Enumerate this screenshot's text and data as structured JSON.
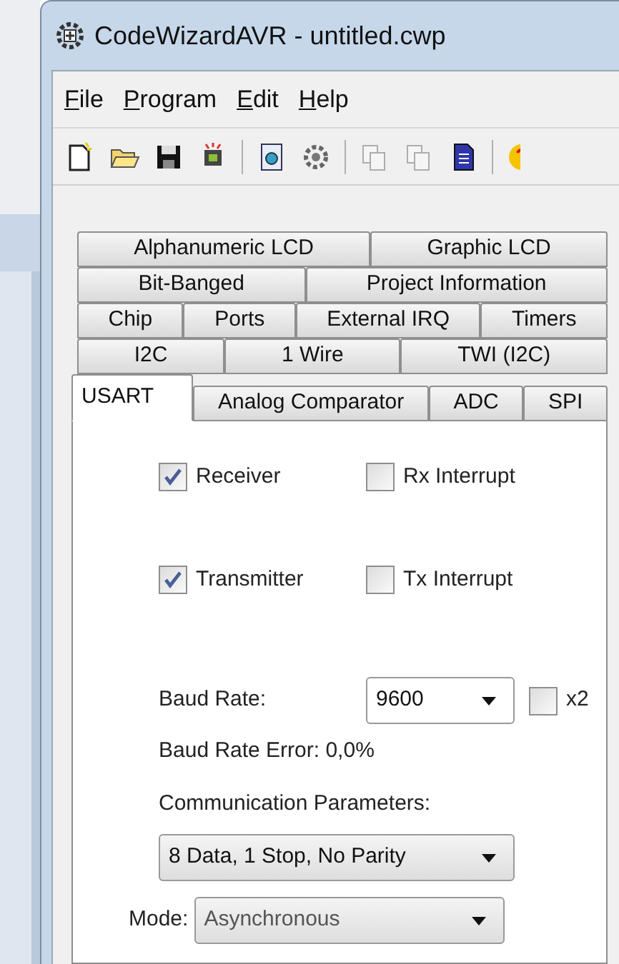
{
  "window": {
    "title": "CodeWizardAVR - untitled.cwp"
  },
  "menu": [
    {
      "label": "File"
    },
    {
      "label": "Program"
    },
    {
      "label": "Edit"
    },
    {
      "label": "Help"
    }
  ],
  "toolbar": [
    {
      "kind": "new",
      "disabled": false
    },
    {
      "kind": "open",
      "disabled": false
    },
    {
      "kind": "save",
      "disabled": false
    },
    {
      "kind": "chip",
      "disabled": false
    },
    {
      "kind": "separator"
    },
    {
      "kind": "preview",
      "disabled": false
    },
    {
      "kind": "gears",
      "disabled": false
    },
    {
      "kind": "separator"
    },
    {
      "kind": "copy",
      "disabled": true
    },
    {
      "kind": "copy",
      "disabled": true
    },
    {
      "kind": "document",
      "disabled": false
    },
    {
      "kind": "separator"
    },
    {
      "kind": "help",
      "disabled": false
    }
  ],
  "tab_rows": [
    [
      {
        "label": "Alphanumeric LCD",
        "selected": false
      },
      {
        "label": "Graphic LCD",
        "selected": false
      }
    ],
    [
      {
        "label": "Bit-Banged",
        "selected": false
      },
      {
        "label": "Project Information",
        "selected": false
      }
    ],
    [
      {
        "label": "Chip",
        "selected": false
      },
      {
        "label": "Ports",
        "selected": false
      },
      {
        "label": "External IRQ",
        "selected": false
      },
      {
        "label": "Timers",
        "selected": false
      }
    ],
    [
      {
        "label": "I2C",
        "selected": false
      },
      {
        "label": "1 Wire",
        "selected": false
      },
      {
        "label": "TWI (I2C)",
        "selected": false
      }
    ],
    [
      {
        "label": "USART",
        "selected": true
      },
      {
        "label": "Analog Comparator",
        "selected": false
      },
      {
        "label": "ADC",
        "selected": false
      },
      {
        "label": "SPI",
        "selected": false
      }
    ]
  ],
  "usart": {
    "checkbox_rows": [
      [
        {
          "label": "Receiver",
          "checked": true
        },
        {
          "label": "Rx Interrupt",
          "checked": false
        }
      ],
      [
        {
          "label": "Transmitter",
          "checked": true
        },
        {
          "label": "Tx Interrupt",
          "checked": false
        }
      ]
    ],
    "baud_rate": {
      "label": "Baud Rate:",
      "value": "9600",
      "x2": {
        "label": "x2",
        "checked": false
      }
    },
    "baud_rate_error": "Baud Rate Error: 0,0%",
    "communication_parameters": {
      "label": "Communication Parameters:",
      "value": "8 Data, 1 Stop, No Parity"
    },
    "mode": {
      "label": "Mode:",
      "value": "Asynchronous"
    }
  }
}
